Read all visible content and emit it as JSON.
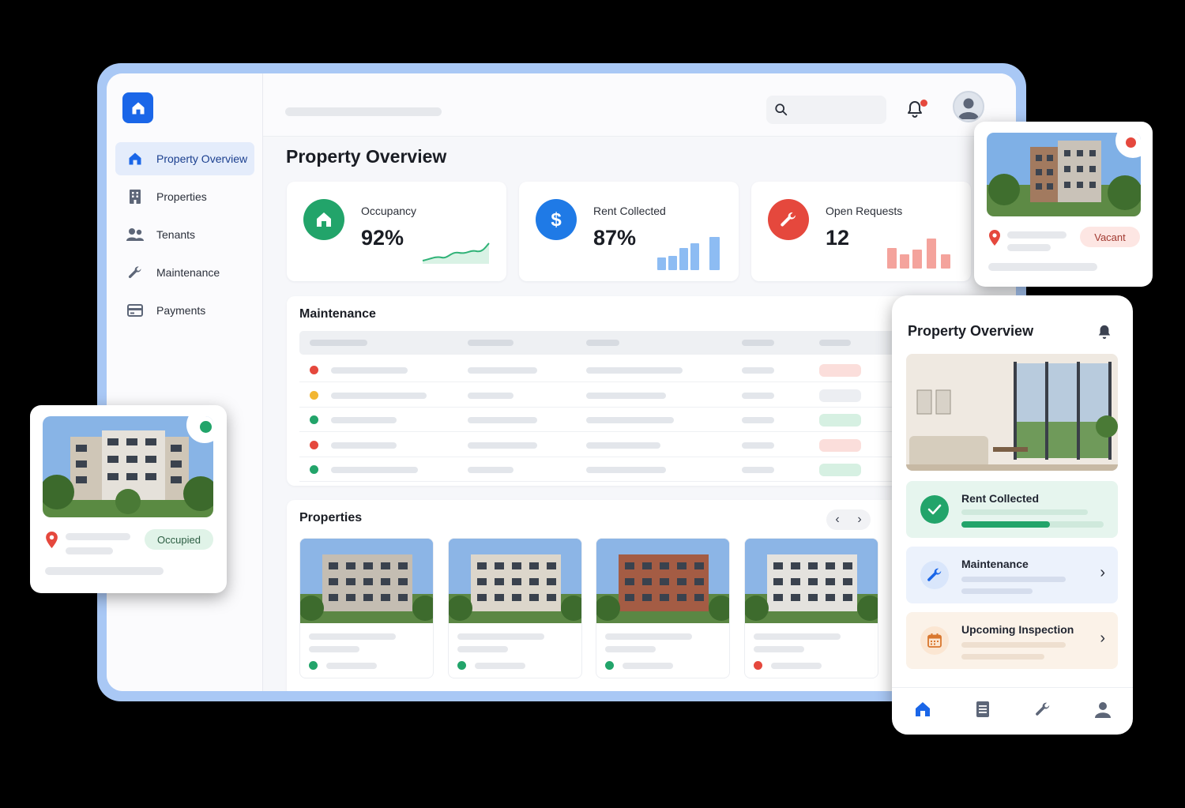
{
  "sidebar": {
    "items": [
      {
        "label": "Property Overview",
        "icon": "home-icon",
        "active": true
      },
      {
        "label": "Properties",
        "icon": "building-icon"
      },
      {
        "label": "Tenants",
        "icon": "users-icon"
      },
      {
        "label": "Maintenance",
        "icon": "wrench-icon"
      },
      {
        "label": "Payments",
        "icon": "credit-card-icon"
      }
    ]
  },
  "main": {
    "title": "Property Overview",
    "kpis": [
      {
        "label": "Occupancy",
        "value": "92%",
        "color": "#22a46a",
        "icon": "home-icon"
      },
      {
        "label": "Rent Collected",
        "value": "87%",
        "color": "#1f7ae6",
        "icon": "dollar-icon"
      },
      {
        "label": "Open Requests",
        "value": "12",
        "color": "#e5483d",
        "icon": "wrench-icon"
      }
    ],
    "maintenance": {
      "title": "Maintenance",
      "row_status_colors": [
        "#e5483d",
        "#f2b632",
        "#22a46a",
        "#e5483d",
        "#22a46a"
      ]
    },
    "properties": {
      "title": "Properties",
      "prev": "‹",
      "next": "›",
      "card_status_colors": [
        "#22a46a",
        "#22a46a",
        "#22a46a",
        "#e5483d"
      ]
    }
  },
  "float_vacant": {
    "status": "Vacant"
  },
  "float_occupied": {
    "status": "Occupied"
  },
  "mobile": {
    "title": "Property Overview",
    "rows": [
      {
        "label": "Rent Collected",
        "progress": 0.62
      },
      {
        "label": "Maintenance"
      },
      {
        "label": "Upcoming Inspection"
      }
    ],
    "tabs": [
      "home-icon",
      "document-icon",
      "wrench-icon",
      "profile-icon"
    ]
  },
  "colors": {
    "accent": "#1a66e8",
    "success": "#22a46a",
    "danger": "#e5483d",
    "warning": "#f2b632"
  }
}
